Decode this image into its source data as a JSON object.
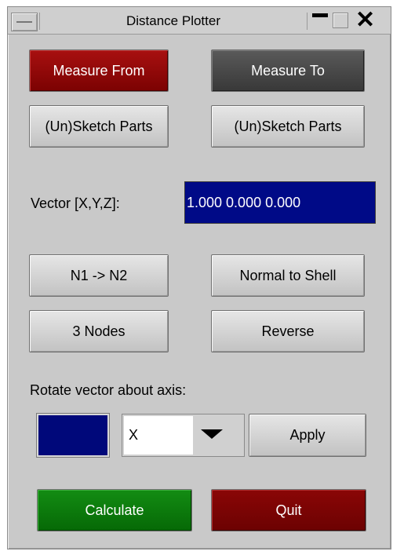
{
  "window": {
    "title": "Distance Plotter"
  },
  "measure": {
    "from_label": "Measure From",
    "to_label": "Measure To",
    "sketch_from_label": "(Un)Sketch Parts",
    "sketch_to_label": "(Un)Sketch Parts"
  },
  "vector": {
    "label": "Vector [X,Y,Z]:",
    "value": "1.000 0.000 0.000"
  },
  "direction_buttons": {
    "n1_n2": "N1 -> N2",
    "normal_to_shell": "Normal to Shell",
    "three_nodes": "3 Nodes",
    "reverse": "Reverse"
  },
  "rotate": {
    "label": "Rotate vector about axis:",
    "axis_value": "X",
    "apply_label": "Apply"
  },
  "actions": {
    "calculate_label": "Calculate",
    "quit_label": "Quit"
  },
  "colors": {
    "measure_from": "#8b0000",
    "measure_to": "#4a4a4a",
    "vector_field": "#000a87",
    "swatch": "#00087a",
    "calculate": "#0a7a0a",
    "quit": "#7a0404"
  },
  "icons": {
    "menu": "window-menu-icon",
    "minimize": "minimize-icon",
    "maximize": "maximize-icon",
    "close": "close-icon",
    "dropdown": "chevron-down-icon"
  }
}
